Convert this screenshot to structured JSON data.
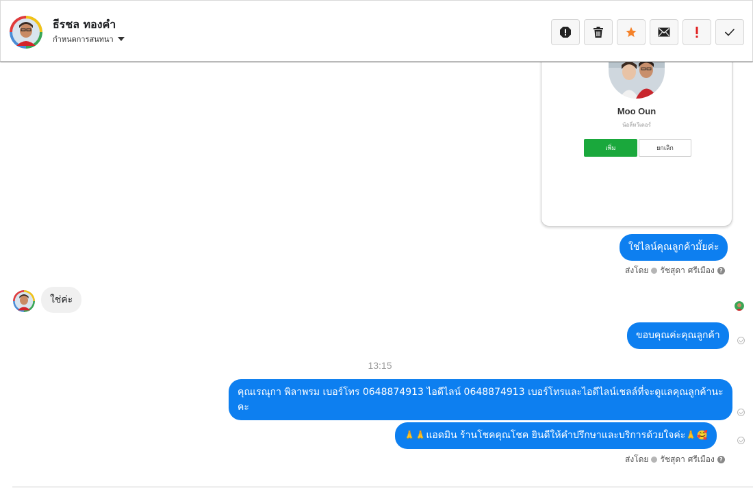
{
  "header": {
    "contact_name": "ธีรชล ทองคำ",
    "assign_label": "กำหนดการสนทนา"
  },
  "toolbar": {
    "buttons": [
      "spam-icon",
      "trash-icon",
      "star-icon",
      "mail-icon",
      "exclamation-icon",
      "check-icon"
    ],
    "star_color": "#f5822a",
    "exclamation_color": "#e02020"
  },
  "card": {
    "name": "Moo Oun",
    "subtitle": "น้อลี่หวีเตอร์",
    "add_label": "เพิ่ม",
    "cancel_label": "ยกเลิก"
  },
  "messages": {
    "m1": "ใช่ไลน์คุณลูกค้ามั้ยค่ะ",
    "sent_by_prefix": "ส่งโดย",
    "sent_by_name": "รัชสุดา ศรีเมือง",
    "m2": "ใช่ค่ะ",
    "m3": "ขอบคุณค่ะคุณลูกค้า",
    "time": "13:15",
    "m4": "คุณเรณุกา พิลาพรม        เบอร์โทร 0648874913  ไอดีไลน์ 0648874913   เบอร์โทรและไอดีไลน์เชลล์ที่จะดูแลคุณลูกค้านะคะ",
    "m5_prefix": "🙏🙏",
    "m5_text": "แอดมิน ร้านโชคคุณโชค ยินดีให้คำปรึกษาและบริการด้วยใจค่ะ",
    "m5_suffix": "🙏🥰"
  },
  "colors": {
    "outgoing_bubble": "#0d7ff0",
    "incoming_bubble": "#f0f0f0",
    "add_button": "#1aa83c"
  }
}
